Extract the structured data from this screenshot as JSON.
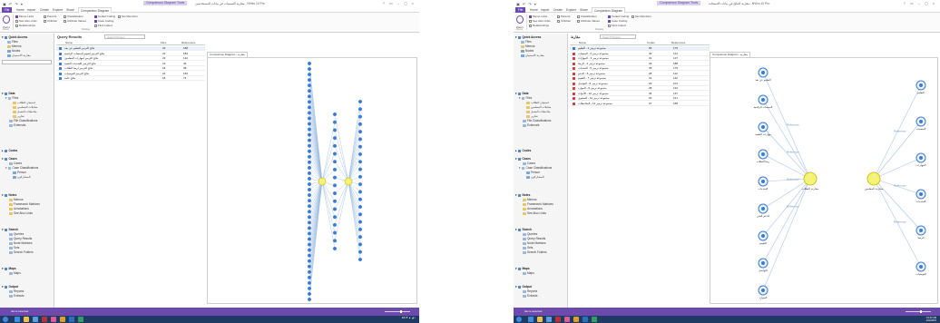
{
  "app": {
    "context_tab": "Comparison Diagram Tools",
    "window_title_left": "مقارنة التسميات في بيانات المستخدمين - NVivo 10 Pro",
    "window_title_right": "مقارنة النتائج في بيانات الاستجابة - NVivo 10 Pro",
    "window_controls": "? ▭ – ◻ ×",
    "quick_tools": "▣ ↶ ↷ ▾"
  },
  "ribbon": {
    "tabs": [
      "File",
      "Home",
      "Import",
      "Create",
      "Explore",
      "Share",
      "Comparison Diagram"
    ],
    "zoom_label": "Zoom",
    "options": [
      {
        "label": "Memo Links",
        "checked": true
      },
      {
        "label": "See Also Links",
        "checked": false
      },
      {
        "label": "Relationships",
        "checked": false
      },
      {
        "label": "Parents",
        "checked": false
      },
      {
        "label": "Children",
        "checked": false
      },
      {
        "label": "Classification",
        "checked": false
      },
      {
        "label": "Attribute Values",
        "checked": false
      },
      {
        "label": "Coded Coding",
        "checked": true
      },
      {
        "label": "Case Coding",
        "checked": true
      },
      {
        "label": "Find Coded",
        "checked": false
      },
      {
        "label": "Set Members",
        "checked": false
      }
    ],
    "group_zoom": "Zoom",
    "group_display": "Display"
  },
  "nav": {
    "quick_access": "Quick Access",
    "quick_items": [
      "Files",
      "Memos",
      "Nodes",
      "مقارنة الاستبيان"
    ],
    "search_value": "",
    "data": "Data",
    "files": "Files",
    "data_children": [
      "استبيان الطلاب",
      "مقابلات المعلمين",
      "ملاحظات الفصل",
      "تقارير"
    ],
    "file_classifications": "File Classifications",
    "externals": "Externals",
    "codes": "Codes",
    "cases": "Cases",
    "cases_children": [
      "Cases",
      "Case Classifications",
      "Person",
      "المشاركون"
    ],
    "notes": "Notes",
    "notes_children": [
      "Memos",
      "Framework Matrices",
      "Annotations",
      "See Also Links"
    ],
    "search": "Search",
    "search_children": [
      "Queries",
      "Query Results",
      "Node Matrices",
      "Sets",
      "Search Folders"
    ],
    "maps": "Maps",
    "maps_children": [
      "Maps"
    ],
    "output": "Output",
    "output_children": [
      "Reports",
      "Extracts"
    ]
  },
  "left_panel": {
    "title": "Query Results",
    "search_placeholder": "Search Project",
    "col_name": "Name",
    "col_files": "Files",
    "col_refs": "References",
    "rows": [
      {
        "name": "نتائج الترميز للتعليم عن بعد",
        "files": "31",
        "refs": "188"
      },
      {
        "name": "نتائج الترميز لتقييم المنصات الرقمية",
        "files": "22",
        "refs": "184"
      },
      {
        "name": "نتائج الترميز لمهارات المعلمين",
        "files": "23",
        "refs": "132"
      },
      {
        "name": "نتائج الترميز للتحديات التقنية",
        "files": "19",
        "refs": "46"
      },
      {
        "name": "نتائج الترميز لرضا الطلاب",
        "files": "18",
        "refs": "38"
      },
      {
        "name": "نتائج الترميز للتوصيات",
        "files": "22",
        "refs": "160"
      },
      {
        "name": "نتائج عامة",
        "files": "18",
        "refs": "74"
      }
    ],
    "map_tab": "Comparison Diagram - مقارنة"
  },
  "right_panel": {
    "title": "مقارنة",
    "search_placeholder": "Search Project",
    "col_name": "Name",
    "col_files": "Codes",
    "col_refs": "References",
    "rows": [
      {
        "name": "مجموعة ترميز 1 - التعليم",
        "files": "56",
        "refs": "175",
        "color": "#3a7bd5"
      },
      {
        "name": "مجموعة ترميز 2 - المنصات",
        "files": "40",
        "refs": "121",
        "color": "#d04040"
      },
      {
        "name": "مجموعة ترميز 3 - المهارات",
        "files": "31",
        "refs": "127",
        "color": "#d04040"
      },
      {
        "name": "مجموعة ترميز 4 - الرضا",
        "files": "33",
        "refs": "188",
        "color": "#d04040"
      },
      {
        "name": "مجموعة ترميز 5 - التحديات",
        "files": "35",
        "refs": "175",
        "color": "#d04040"
      },
      {
        "name": "مجموعة ترميز 6 - الدعم",
        "files": "28",
        "refs": "112",
        "color": "#d04040"
      },
      {
        "name": "مجموعة ترميز 7 - التقييم",
        "files": "31",
        "refs": "142",
        "color": "#d04040"
      },
      {
        "name": "مجموعة ترميز 8 - التواصل",
        "files": "29",
        "refs": "101",
        "color": "#d04040"
      },
      {
        "name": "مجموعة ترميز 9 - الموارد",
        "files": "28",
        "refs": "132",
        "color": "#d04040"
      },
      {
        "name": "مجموعة ترميز 10 - الأدوات",
        "files": "36",
        "refs": "137",
        "color": "#d04040"
      },
      {
        "name": "مجموعة ترميز 11 - المحتوى",
        "files": "30",
        "refs": "121",
        "color": "#d04040"
      },
      {
        "name": "مجموعة ترميز 12 - الملاحظات",
        "files": "37",
        "refs": "168",
        "color": "#d04040"
      }
    ],
    "map_tab": "Comparison Diagram - مقارنة",
    "hub_left": "مقارنة الطلاب",
    "hub_right": "مقارنة المعلمين",
    "edge_label": "Reference",
    "nodes_left": [
      "التعليم عن بعد",
      "المنصات الرقمية",
      "مهارات التقنية",
      "رضا الطلاب",
      "التحديات",
      "الدعم الفني",
      "التقييم",
      "التواصل",
      "الموارد"
    ],
    "nodes_right": [
      "التعليم",
      "المنصات",
      "المهارات",
      "التحديات",
      "الرضا",
      "التوصيات"
    ]
  },
  "status": {
    "left": "Items selected",
    "right": "Items selected",
    "zoom_left": 0.65,
    "zoom_right": 0.6
  },
  "taskbar": {
    "time": "10:42 AM",
    "date": "4/12/2015",
    "tray": "EN ⚑ ▲ ◢ ◐"
  },
  "colors": {
    "accent": "#6d4aad",
    "taskbar": "#1f3b63",
    "hub": "#f5f27a",
    "node": "#3a7bd5"
  }
}
